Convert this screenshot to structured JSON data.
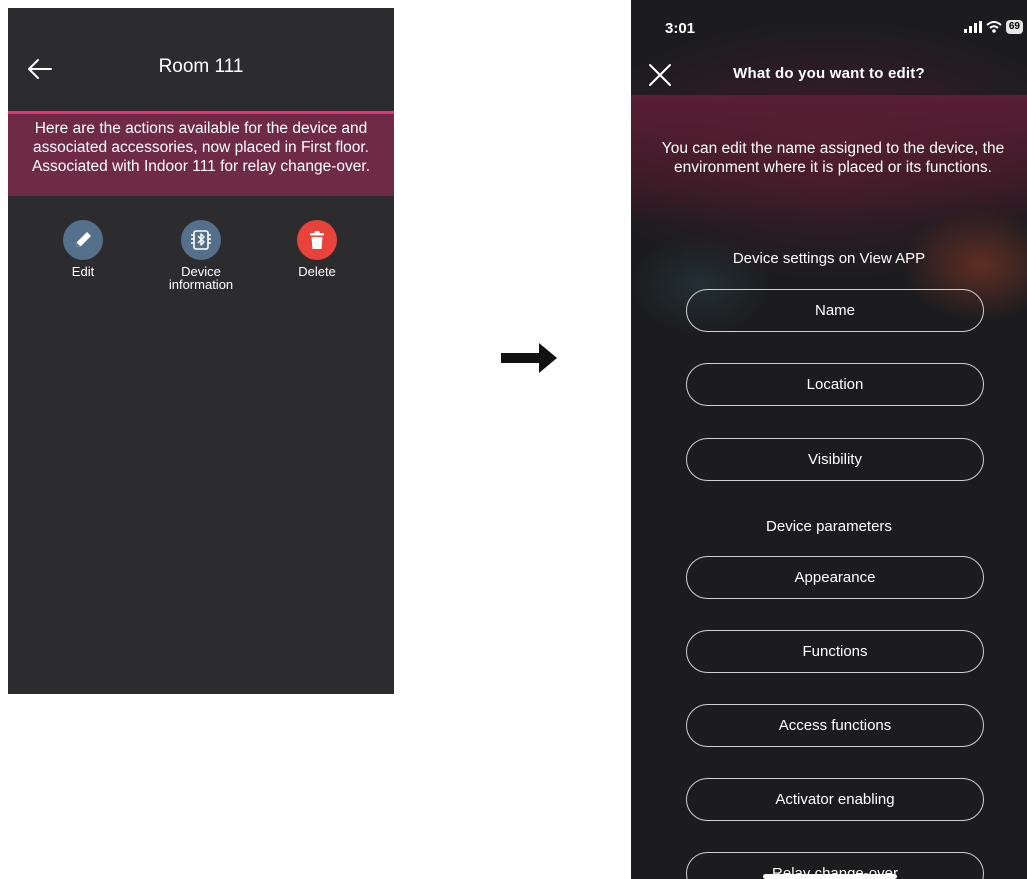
{
  "left": {
    "title": "Room 111",
    "banner": "Here are the actions available for the device and associated accessories, now placed in First floor. Associated with Indoor 111 for relay change-over.",
    "actions": [
      {
        "label": "Edit",
        "icon": "pencil-icon",
        "color": "#55708a"
      },
      {
        "label": "Device information",
        "icon": "bluetooth-chip-icon",
        "color": "#55708a"
      },
      {
        "label": "Delete",
        "icon": "trash-icon",
        "color": "#e8423a"
      }
    ]
  },
  "right": {
    "status": {
      "time": "3:01",
      "battery": "69"
    },
    "title": "What do you want to edit?",
    "subtitle": "You can edit the name assigned to the device, the environment where it is placed or its functions.",
    "section1": {
      "heading": "Device settings on View APP",
      "items": [
        "Name",
        "Location",
        "Visibility"
      ]
    },
    "section2": {
      "heading": "Device parameters",
      "items": [
        "Appearance",
        "Functions",
        "Access functions",
        "Activator enabling",
        "Relay change-over"
      ]
    }
  },
  "colors": {
    "left_bg": "#2c2c2e",
    "banner_bg": "#6f2b45",
    "banner_accent": "#e0357a",
    "right_bg": "#1c1c1e"
  }
}
